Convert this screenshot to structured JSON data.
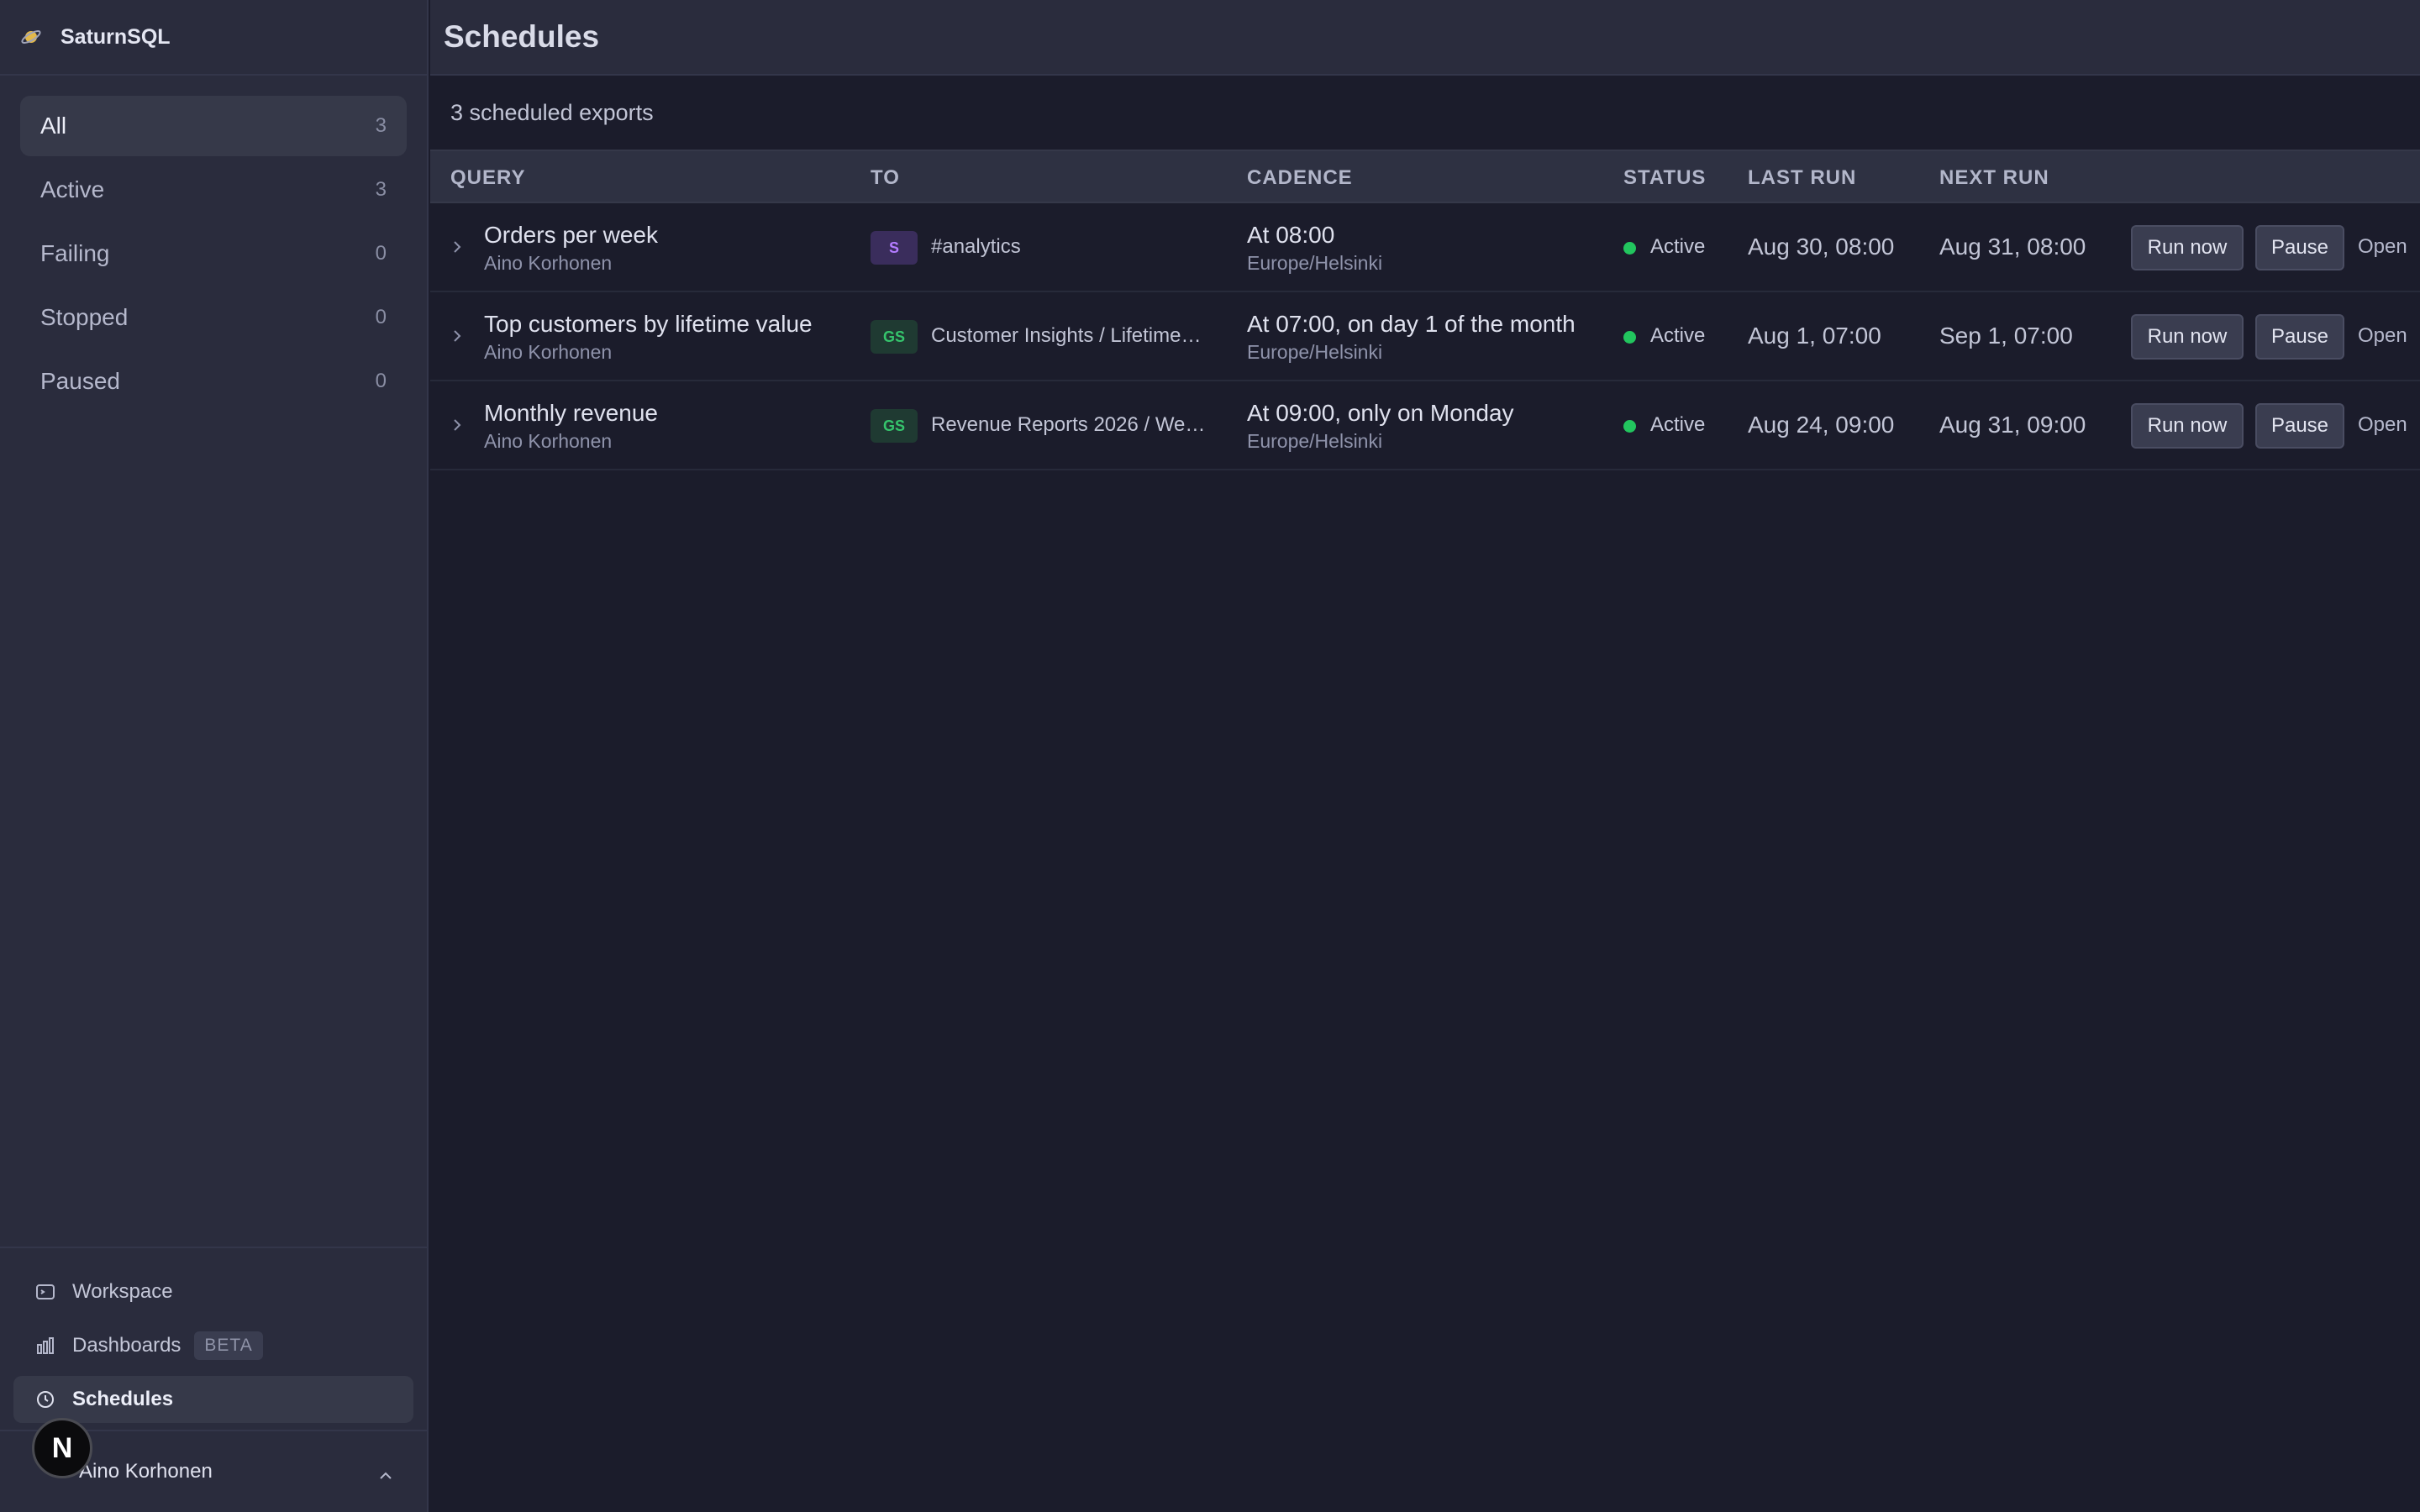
{
  "app": {
    "name": "SaturnSQL"
  },
  "sidebar": {
    "filters": [
      {
        "label": "All",
        "count": "3",
        "active": true
      },
      {
        "label": "Active",
        "count": "3"
      },
      {
        "label": "Failing",
        "count": "0"
      },
      {
        "label": "Stopped",
        "count": "0"
      },
      {
        "label": "Paused",
        "count": "0"
      }
    ],
    "nav": [
      {
        "label": "Workspace",
        "icon": "terminal-icon"
      },
      {
        "label": "Dashboards",
        "icon": "bar-chart-icon",
        "badge": "BETA"
      },
      {
        "label": "Schedules",
        "icon": "clock-icon",
        "active": true
      }
    ],
    "user": {
      "name": "Aino Korhonen",
      "overlay_badge": "N"
    }
  },
  "header": {
    "title": "Schedules"
  },
  "summary": "3 scheduled exports",
  "table": {
    "columns": [
      "QUERY",
      "TO",
      "CADENCE",
      "STATUS",
      "LAST RUN",
      "NEXT RUN"
    ],
    "rows": [
      {
        "query": "Orders per week",
        "owner": "Aino Korhonen",
        "dest_badge": "S",
        "dest_type": "slack",
        "destination": "#analytics",
        "cadence": "At 08:00",
        "timezone": "Europe/Helsinki",
        "status": "Active",
        "last_run": "Aug 30, 08:00",
        "next_run": "Aug 31, 08:00"
      },
      {
        "query": "Top customers by lifetime value",
        "owner": "Aino Korhonen",
        "dest_badge": "GS",
        "dest_type": "sheets",
        "destination": "Customer Insights / Lifetime…",
        "cadence": "At 07:00, on day 1 of the month",
        "timezone": "Europe/Helsinki",
        "status": "Active",
        "last_run": "Aug 1, 07:00",
        "next_run": "Sep 1, 07:00"
      },
      {
        "query": "Monthly revenue",
        "owner": "Aino Korhonen",
        "dest_badge": "GS",
        "dest_type": "sheets",
        "destination": "Revenue Reports 2026 / We…",
        "cadence": "At 09:00, only on Monday",
        "timezone": "Europe/Helsinki",
        "status": "Active",
        "last_run": "Aug 24, 09:00",
        "next_run": "Aug 31, 09:00"
      }
    ],
    "actions": {
      "run": "Run now",
      "pause": "Pause",
      "open": "Open"
    }
  },
  "colors": {
    "status_active": "#22c55e",
    "slack_badge": "#b37cff",
    "sheets_badge": "#35c46c"
  }
}
